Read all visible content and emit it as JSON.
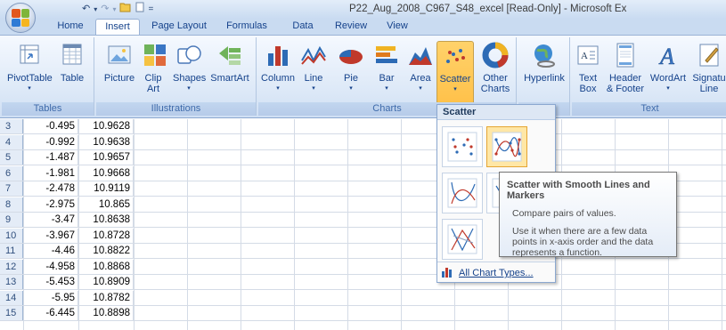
{
  "window": {
    "title": "P22_Aug_2008_C967_S48_excel  [Read-Only] - Microsoft Ex"
  },
  "qat": {
    "save_icon": "save-icon",
    "undo_glyph": "↶",
    "redo_glyph": "↷",
    "open_glyph": "📂",
    "new_glyph": "▭",
    "customize_glyph": "="
  },
  "tabs": [
    {
      "label": "Home"
    },
    {
      "label": "Insert"
    },
    {
      "label": "Page Layout"
    },
    {
      "label": "Formulas"
    },
    {
      "label": "Data"
    },
    {
      "label": "Review"
    },
    {
      "label": "View"
    }
  ],
  "ribbon": {
    "groups": {
      "tables": "Tables",
      "illustrations": "Illustrations",
      "charts": "Charts",
      "text": "Text"
    },
    "buttons": {
      "pivottable": "PivotTable",
      "table": "Table",
      "picture": "Picture",
      "clipart_1": "Clip",
      "clipart_2": "Art",
      "shapes": "Shapes",
      "smartart": "SmartArt",
      "column": "Column",
      "line": "Line",
      "pie": "Pie",
      "bar": "Bar",
      "area": "Area",
      "scatter": "Scatter",
      "othercharts_1": "Other",
      "othercharts_2": "Charts",
      "hyperlink": "Hyperlink",
      "textbox_1": "Text",
      "textbox_2": "Box",
      "header_1": "Header",
      "header_2": "& Footer",
      "wordart": "WordArt",
      "signature_1": "Signatu",
      "signature_2": "Line"
    }
  },
  "sheet": {
    "rows": [
      {
        "num": "3",
        "a": "-0.495",
        "b": "10.9628"
      },
      {
        "num": "4",
        "a": "-0.992",
        "b": "10.9638"
      },
      {
        "num": "5",
        "a": "-1.487",
        "b": "10.9657"
      },
      {
        "num": "6",
        "a": "-1.981",
        "b": "10.9668"
      },
      {
        "num": "7",
        "a": "-2.478",
        "b": "10.9119"
      },
      {
        "num": "8",
        "a": "-2.975",
        "b": "10.865"
      },
      {
        "num": "9",
        "a": "-3.47",
        "b": "10.8638"
      },
      {
        "num": "10",
        "a": "-3.967",
        "b": "10.8728"
      },
      {
        "num": "11",
        "a": "-4.46",
        "b": "10.8822"
      },
      {
        "num": "12",
        "a": "-4.958",
        "b": "10.8868"
      },
      {
        "num": "13",
        "a": "-5.453",
        "b": "10.8909"
      },
      {
        "num": "14",
        "a": "-5.95",
        "b": "10.8782"
      },
      {
        "num": "15",
        "a": "-6.445",
        "b": "10.8898"
      }
    ]
  },
  "gallery": {
    "header": "Scatter",
    "footer_link": "All Chart Types..."
  },
  "tooltip": {
    "title": "Scatter with Smooth Lines and Markers",
    "line1": "Compare pairs of values.",
    "line2": "Use it when there are a few data points in x-axis order and the data represents a function."
  },
  "colors": {
    "accent": "#15428b",
    "pressed": "#ffc14a",
    "ribbon_bg": "#dce8f7"
  }
}
